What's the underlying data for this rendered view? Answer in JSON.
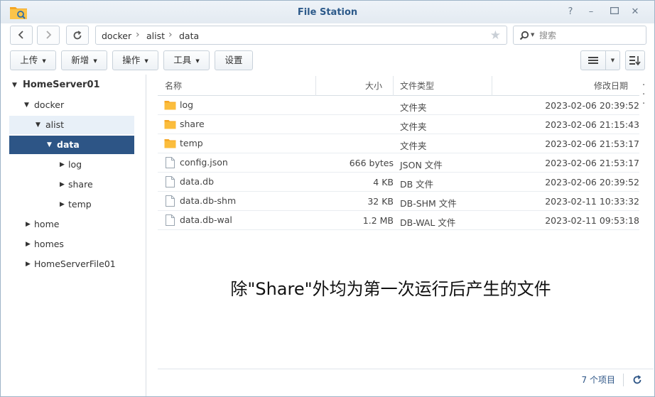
{
  "window": {
    "title": "File Station"
  },
  "icons": {
    "app": "folder-app-icon",
    "back": "chevron-left-icon",
    "forward": "chevron-right-icon",
    "refresh": "refresh-icon",
    "star": "star-icon",
    "search": "search-icon",
    "help": "help-icon",
    "minimize": "minimize-icon",
    "maximize": "maximize-icon",
    "close": "close-icon"
  },
  "breadcrumb": [
    "docker",
    "alist",
    "data"
  ],
  "search": {
    "placeholder": "搜索"
  },
  "toolbar": {
    "upload": "上传",
    "create": "新增",
    "action": "操作",
    "tools": "工具",
    "settings": "设置"
  },
  "tree": {
    "root": "HomeServer01",
    "items": [
      "docker",
      "alist",
      "data",
      "log",
      "share",
      "temp",
      "home",
      "homes",
      "HomeServerFile01"
    ]
  },
  "columns": {
    "name": "名称",
    "size": "大小",
    "type": "文件类型",
    "modified": "修改日期"
  },
  "files": [
    {
      "name": "log",
      "size": "",
      "type": "文件夹",
      "date": "2023-02-06 20:39:52",
      "kind": "folder"
    },
    {
      "name": "share",
      "size": "",
      "type": "文件夹",
      "date": "2023-02-06 21:15:43",
      "kind": "folder"
    },
    {
      "name": "temp",
      "size": "",
      "type": "文件夹",
      "date": "2023-02-06 21:53:17",
      "kind": "folder"
    },
    {
      "name": "config.json",
      "size": "666 bytes",
      "type": "JSON 文件",
      "date": "2023-02-06 21:53:17",
      "kind": "file"
    },
    {
      "name": "data.db",
      "size": "4 KB",
      "type": "DB 文件",
      "date": "2023-02-06 20:39:52",
      "kind": "file"
    },
    {
      "name": "data.db-shm",
      "size": "32 KB",
      "type": "DB-SHM 文件",
      "date": "2023-02-11 10:33:32",
      "kind": "file"
    },
    {
      "name": "data.db-wal",
      "size": "1.2 MB",
      "type": "DB-WAL 文件",
      "date": "2023-02-11 09:53:18",
      "kind": "file"
    }
  ],
  "annotation": "除\"Share\"外均为第一次运行后产生的文件",
  "footer": {
    "count": "7 个项目"
  },
  "colors": {
    "accent": "#2d5586",
    "folder": "#f5a623",
    "title": "#2d5a8a"
  }
}
